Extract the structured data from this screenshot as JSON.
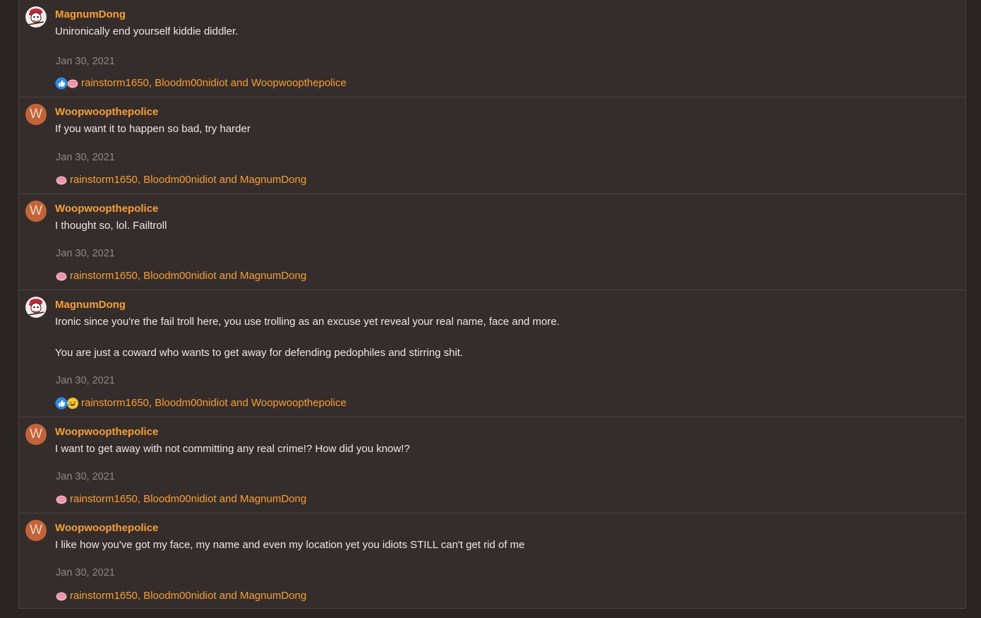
{
  "comments": [
    {
      "username": "MagnumDong",
      "avatar": "magnumdong-avatar-image",
      "body": [
        "Unironically end yourself kiddie diddler."
      ],
      "date": "Jan 30, 2021",
      "reaction_icons": [
        "like-icon",
        "brain-icon"
      ],
      "reactions": "rainstorm1650, Bloodm00nidiot and Woopwoopthepolice"
    },
    {
      "username": "Woopwoopthepolice",
      "avatar_letter": "W",
      "body": [
        "If you want it to happen so bad, try harder"
      ],
      "date": "Jan 30, 2021",
      "reaction_icons": [
        "brain-icon"
      ],
      "reactions": "rainstorm1650, Bloodm00nidiot and MagnumDong"
    },
    {
      "username": "Woopwoopthepolice",
      "avatar_letter": "W",
      "body": [
        "I thought so, lol. Failtroll"
      ],
      "date": "Jan 30, 2021",
      "reaction_icons": [
        "brain-icon"
      ],
      "reactions": "rainstorm1650, Bloodm00nidiot and MagnumDong"
    },
    {
      "username": "MagnumDong",
      "avatar": "magnumdong-avatar-image",
      "body": [
        "Ironic since you're the fail troll here, you use trolling as an excuse yet reveal your real name, face and more.",
        "You are just a coward who wants to get away for defending pedophiles and stirring shit."
      ],
      "date": "Jan 30, 2021",
      "reaction_icons": [
        "like-icon",
        "laugh-icon"
      ],
      "reactions": "rainstorm1650, Bloodm00nidiot and Woopwoopthepolice"
    },
    {
      "username": "Woopwoopthepolice",
      "avatar_letter": "W",
      "body": [
        "I want to get away with not committing any real crime!? How did you know!?"
      ],
      "date": "Jan 30, 2021",
      "reaction_icons": [
        "brain-icon"
      ],
      "reactions": "rainstorm1650, Bloodm00nidiot and MagnumDong"
    },
    {
      "username": "Woopwoopthepolice",
      "avatar_letter": "W",
      "body": [
        "I like how you've got my face, my name and even my location yet you idiots STILL can't get rid of me"
      ],
      "date": "Jan 30, 2021",
      "reaction_icons": [
        "brain-icon"
      ],
      "reactions": "rainstorm1650, Bloodm00nidiot and MagnumDong"
    }
  ],
  "colors": {
    "background": "#2a2423",
    "panel": "#352d2b",
    "divider": "#4a4240",
    "username": "#f7a036",
    "body_text": "#ece8e6",
    "date": "#8e8684",
    "avatar_letter_bg": "#c2643a"
  }
}
